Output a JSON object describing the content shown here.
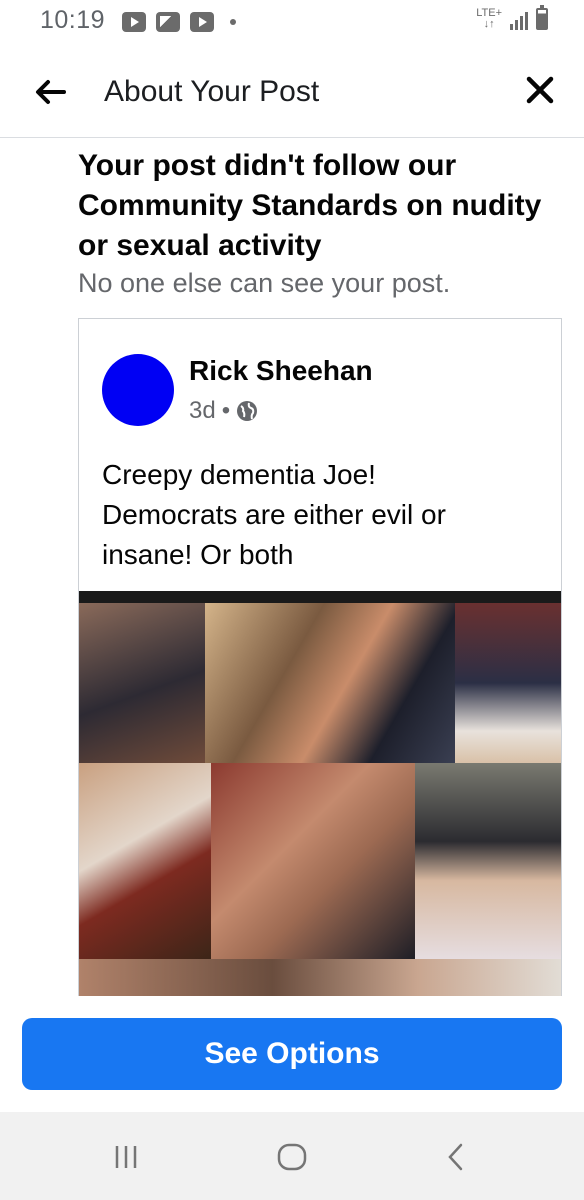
{
  "status_bar": {
    "time": "10:19",
    "network": "LTE+",
    "icons": [
      "youtube-icon",
      "gallery-icon",
      "youtube-icon",
      "dot-icon",
      "signal-icon",
      "battery-icon"
    ]
  },
  "header": {
    "title": "About Your Post",
    "back_icon": "arrow-left-icon",
    "close_icon": "close-icon"
  },
  "notice": {
    "heading": "Your post didn't follow our Community Standards on nudity or sexual activity",
    "subheading": "No one else can see your post."
  },
  "post": {
    "author": "Rick Sheehan",
    "time": "3d",
    "separator": "•",
    "audience_icon": "globe-icon",
    "avatar_color": "#0000f4",
    "text": "Creepy dementia Joe!\nDemocrats are either evil or insane!  Or both",
    "image": "photo-collage"
  },
  "actions": {
    "primary_label": "See Options",
    "primary_color": "#1877f2"
  },
  "nav_bar": {
    "items": [
      "recent-apps-icon",
      "home-icon",
      "back-icon"
    ]
  }
}
